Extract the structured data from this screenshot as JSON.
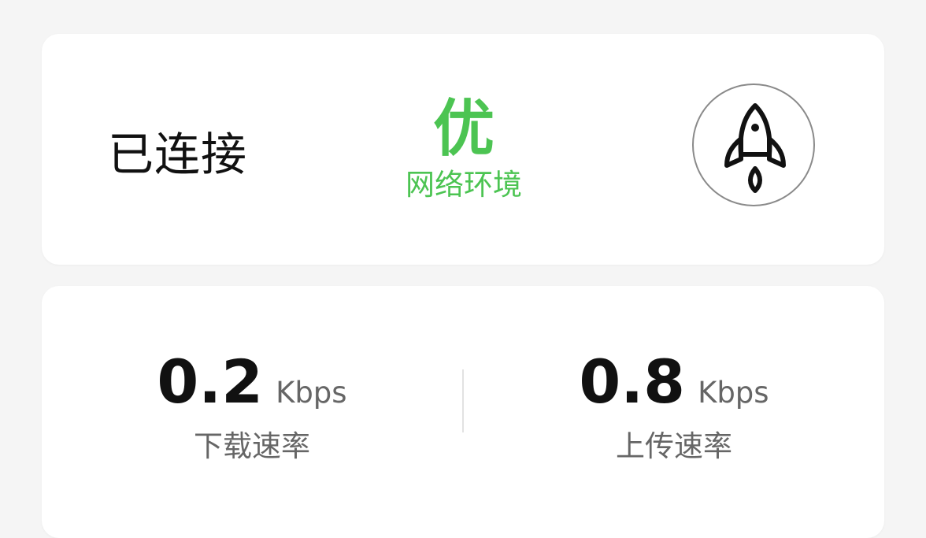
{
  "status": {
    "connection_label": "已连接",
    "network_quality": "优",
    "network_quality_label": "网络环境",
    "boost_icon": "rocket-icon"
  },
  "speed": {
    "download": {
      "value": "0.2",
      "unit": "Kbps",
      "label": "下载速率"
    },
    "upload": {
      "value": "0.8",
      "unit": "Kbps",
      "label": "上传速率"
    }
  },
  "colors": {
    "accent_green": "#4cc452",
    "background": "#f5f5f5",
    "card": "#ffffff"
  }
}
